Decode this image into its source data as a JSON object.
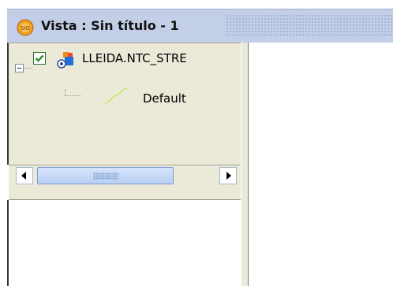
{
  "window": {
    "title": "Vista : Sin título - 1",
    "app_icon": "gvsig-logo-icon"
  },
  "toc": {
    "layers": [
      {
        "name": "LLEIDA.NTC_STRE",
        "checked": true,
        "expanded": true,
        "icon": "vector-layer-icon",
        "legend": [
          {
            "label": "Default",
            "symbol": "line-symbol-icon",
            "color": "#c8e86a"
          }
        ]
      }
    ]
  },
  "colors": {
    "titlebar": "#c3cfe6",
    "panel": "#ebe9d8",
    "check": "#2e8b2e",
    "scroll_thumb": "#c6daf7"
  }
}
